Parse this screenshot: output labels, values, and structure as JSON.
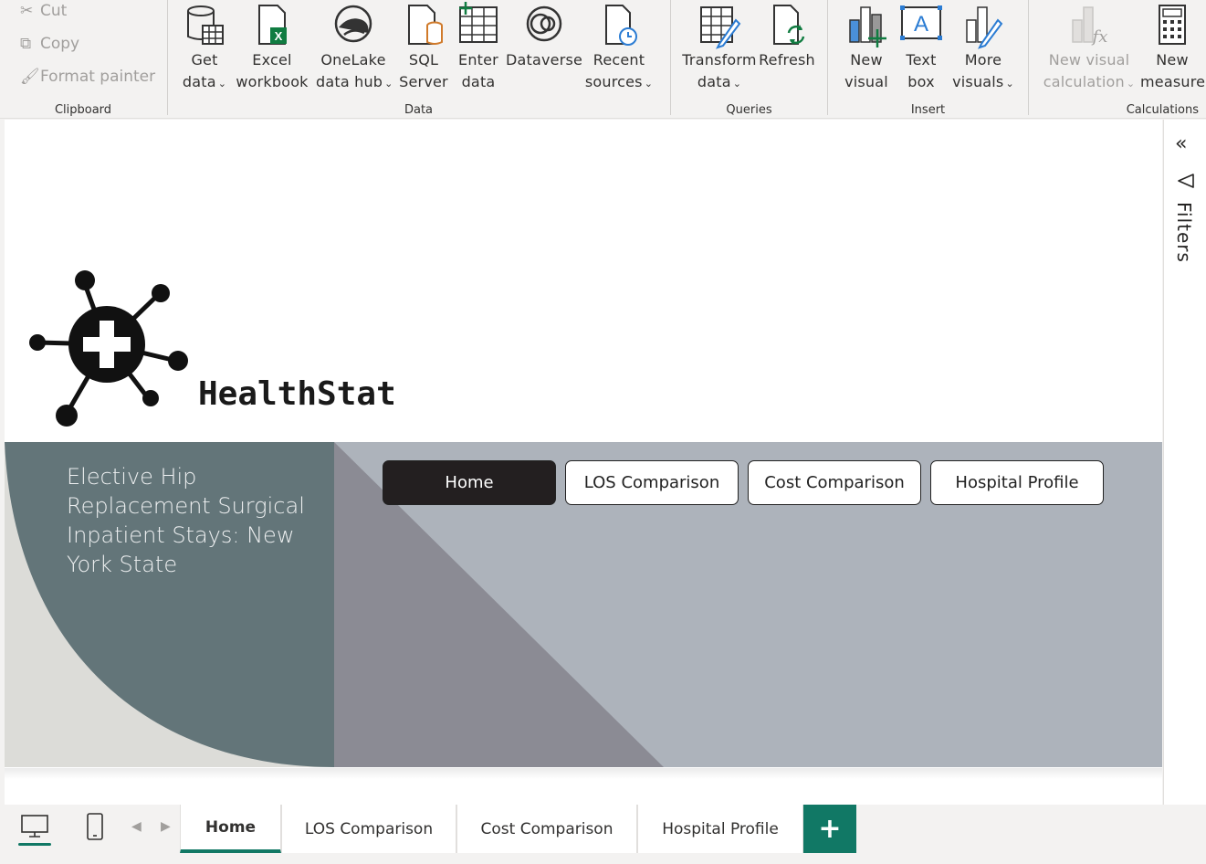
{
  "ribbon": {
    "clipboard": {
      "cut": "Cut",
      "copy": "Copy",
      "format_painter": "Format painter",
      "group_label": "Clipboard"
    },
    "data": {
      "get_data": [
        "Get",
        "data"
      ],
      "excel": [
        "Excel",
        "workbook"
      ],
      "onelake": [
        "OneLake",
        "data hub"
      ],
      "sql": [
        "SQL",
        "Server"
      ],
      "enter": [
        "Enter",
        "data"
      ],
      "dataverse": "Dataverse",
      "recent": [
        "Recent",
        "sources"
      ],
      "group_label": "Data"
    },
    "queries": {
      "transform": [
        "Transform",
        "data"
      ],
      "refresh": "Refresh",
      "group_label": "Queries"
    },
    "insert": {
      "new_visual": [
        "New",
        "visual"
      ],
      "text_box": [
        "Text",
        "box"
      ],
      "more_visuals": [
        "More",
        "visuals"
      ],
      "group_label": "Insert"
    },
    "calculations": {
      "new_visual_calc": [
        "New visual",
        "calculation"
      ],
      "new_measure": [
        "New",
        "measure"
      ],
      "group_label": "Calculations"
    }
  },
  "report": {
    "brand": "HealthStat",
    "banner_title": "Elective Hip Replacement Surgical Inpatient Stays: New York State",
    "nav_buttons": [
      "Home",
      "LOS Comparison",
      "Cost Comparison",
      "Hospital Profile"
    ],
    "active_nav": "Home"
  },
  "filters": {
    "label": "Filters"
  },
  "tabs": {
    "items": [
      "Home",
      "LOS Comparison",
      "Cost Comparison",
      "Hospital Profile"
    ],
    "active": "Home",
    "add": "+"
  },
  "colors": {
    "accent": "#117865",
    "banner_gray": "#adb3bb",
    "banner_slate": "#637579",
    "banner_mauve": "#8b8b94",
    "nav_active": "#231f20"
  }
}
